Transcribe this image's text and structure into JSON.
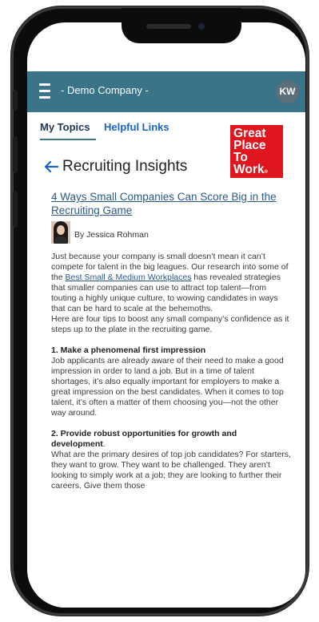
{
  "app": {
    "company_label": "- Demo Company -",
    "user_initials": "KW"
  },
  "tabs": [
    {
      "label": "My Topics",
      "active": true
    },
    {
      "label": "Helpful Links",
      "active": false
    }
  ],
  "logo": {
    "line1": "Great",
    "line2": "Place",
    "line3": "To",
    "line4": "Work",
    "reg": "®",
    "color": "#e0161e"
  },
  "page": {
    "title": "Recruiting Insights",
    "back_icon": "arrow-left-icon"
  },
  "article": {
    "title": "4 Ways Small Companies Can Score Big in the Recruiting Game",
    "byline": "By Jessica Rohman",
    "intro_1": "Just because your company is small doesn’t mean it can’t compete for talent in the big leagues. Our research into some of the ",
    "intro_link": "Best Small & Medium Workplaces",
    "intro_2": " has revealed strategies that smaller companies can use to attract top talent—from touting a highly unique culture, to wowing candidates in ways that can be hard to scale at the behemoths.",
    "intro_3": "Here are four tips to boost any small company’s confidence as it steps up to the plate in the recruiting game.",
    "section1_heading": "1. Make a phenomenal first impression",
    "section1_body": "Job applicants are already aware of their need to make a good impression in order to land a job. But in a time of talent shortages, it’s also equally important for employers to make a great impression on the best candidates. When it comes to top talent, it’s often a matter of them choosing you—not the other way around.",
    "section2_heading": "2. Provide robust opportunities for growth and development",
    "section2_heading_suffix": ".",
    "section2_body": "What are the primary desires of top job candidates? For starters, they want to grow. They want to be challenged. They aren’t looking to simply work at a job; they are looking to further their careers. Give them those"
  },
  "colors": {
    "appbar": "#3a7488",
    "link": "#2b5a8a",
    "tab_link": "#1a63c7"
  }
}
